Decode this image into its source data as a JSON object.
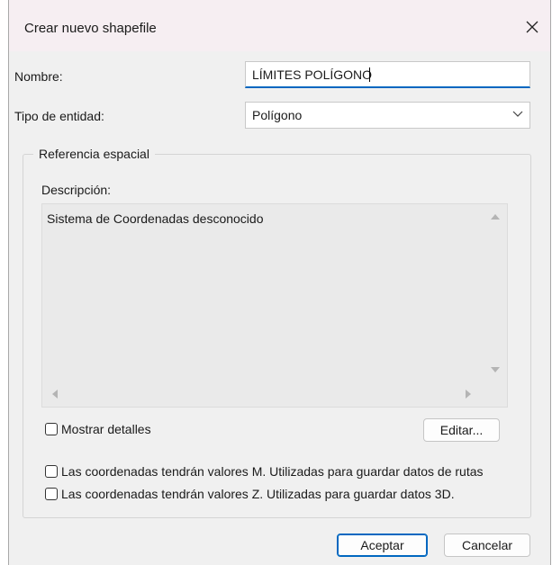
{
  "window": {
    "title": "Crear nuevo shapefile"
  },
  "form": {
    "name_label": "Nombre:",
    "name_value": "LÍMITES POLÍGONO",
    "entity_type_label": "Tipo de entidad:",
    "entity_type_value": "Polígono"
  },
  "spatial_reference": {
    "legend": "Referencia espacial",
    "description_label": "Descripción:",
    "description_text": "Sistema de Coordenadas desconocido",
    "show_details_label": "Mostrar detalles",
    "show_details_checked": false,
    "edit_button": "Editar..."
  },
  "options": {
    "m_values_label": "Las coordenadas tendrán valores M. Utilizadas para guardar datos de rutas",
    "m_values_checked": false,
    "z_values_label": "Las coordenadas tendrán valores Z. Utilizadas para guardar datos 3D.",
    "z_values_checked": false
  },
  "buttons": {
    "ok": "Aceptar",
    "cancel": "Cancelar"
  },
  "colors": {
    "accent": "#0067c0",
    "titlebar": "#f6eef2",
    "dialog_bg": "#f0f0f0"
  },
  "icons": {
    "close": "close-icon",
    "dropdown": "chevron-down-icon"
  }
}
